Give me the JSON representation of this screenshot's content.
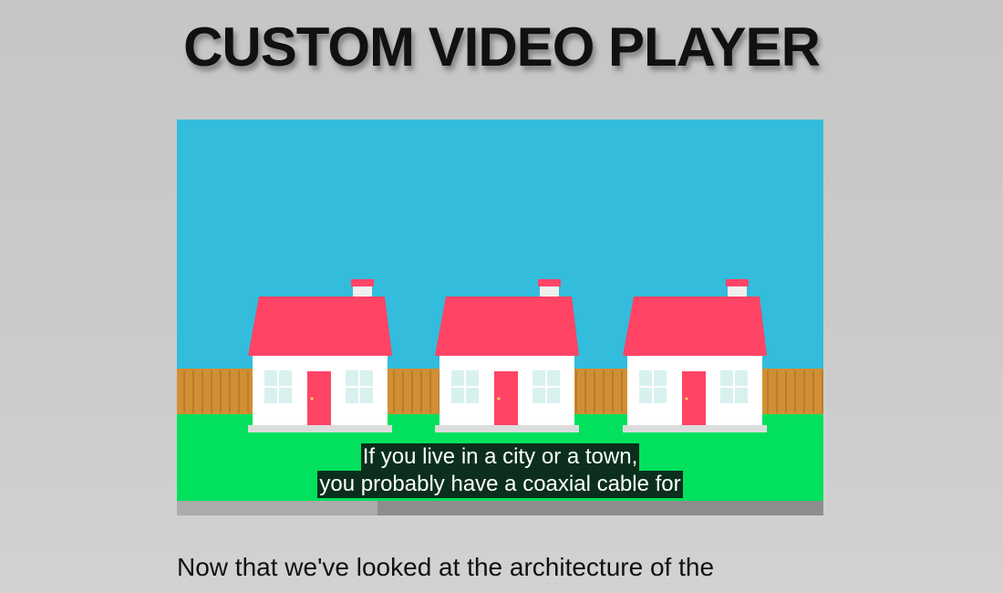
{
  "page": {
    "title": "CUSTOM VIDEO PLAYER"
  },
  "player": {
    "captions": [
      "If you live in a city or a town,",
      "you probably have a coaxial cable for"
    ],
    "progress_fraction": 0.31
  },
  "article": {
    "paragraph": "Now that we've looked at the architecture of the"
  },
  "colors": {
    "sky": "#33bcdc",
    "grass": "#02e15d",
    "roof": "#ff4466",
    "door": "#ff4466",
    "fence": "#d08f34",
    "wall": "#ffffff",
    "window": "#d8f1ef",
    "progress_track": "#8f8c8e",
    "progress_fill": "#adabab",
    "caption_bg": "#0b2f1c"
  }
}
